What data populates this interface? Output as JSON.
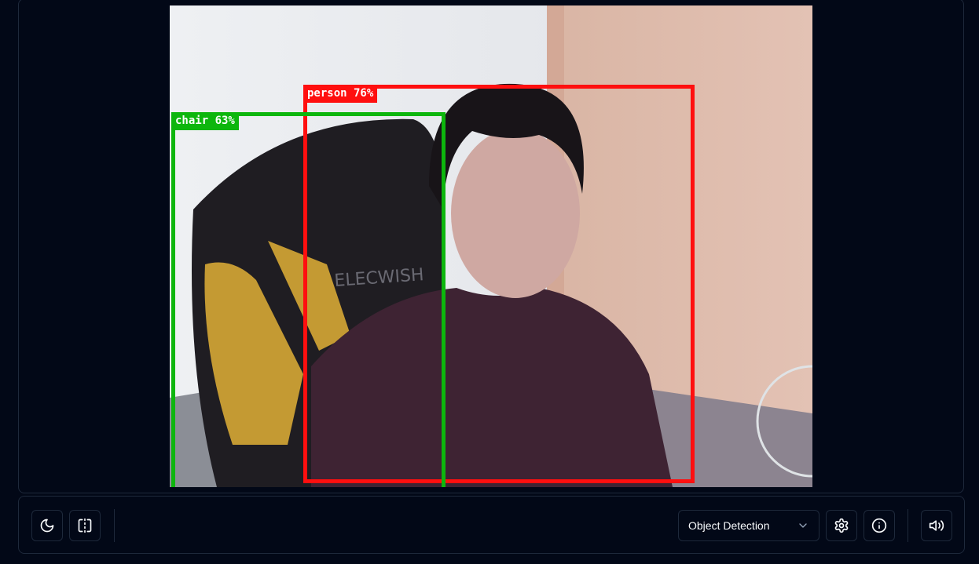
{
  "detections": [
    {
      "label": "person 76%",
      "class": "person",
      "confidence": 0.76,
      "color": "#ff0f0f"
    },
    {
      "label": "chair 63%",
      "class": "chair",
      "confidence": 0.63,
      "color": "#0db60d"
    }
  ],
  "video_text": {
    "chair_brand": "ELECWISH"
  },
  "toolbar": {
    "theme_icon": "moon-icon",
    "mirror_icon": "flip-horizontal-icon",
    "model_select": {
      "value": "Object Detection"
    },
    "settings_icon": "gear-icon",
    "info_icon": "info-icon",
    "volume_icon": "volume-icon"
  },
  "colors": {
    "background": "#020817",
    "border": "#1e293b",
    "text": "#f8fafc"
  }
}
